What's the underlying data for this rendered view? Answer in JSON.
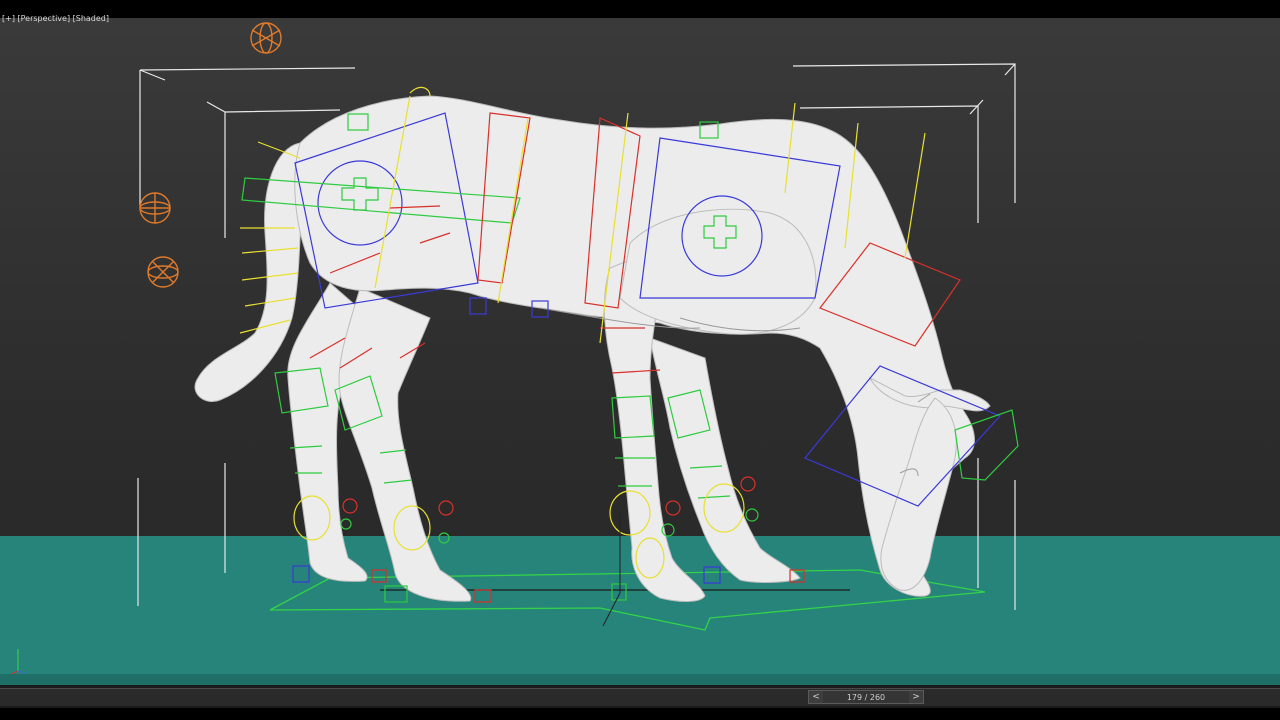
{
  "viewport": {
    "label_parts": [
      "[+]",
      "[Perspective]",
      "[Shaded]"
    ],
    "ground_color": "#26847a",
    "background_color": "#333333",
    "subject": "horse-rig"
  },
  "timeline": {
    "prev_label": "<",
    "next_label": ">",
    "frame_text": "179 / 260",
    "current_frame": 179,
    "total_frames": 260
  },
  "colors": {
    "rig_green": "#2ecc40",
    "rig_red": "#d8302a",
    "rig_blue": "#3a3ad8",
    "rig_yellow": "#e8e030",
    "helper_orange": "#e07a2a",
    "mesh": "#ececec"
  },
  "icons": {
    "axis": "axis-tripod-icon",
    "prev": "chevron-left-icon",
    "next": "chevron-right-icon",
    "helper": "sphere-helper-icon"
  }
}
